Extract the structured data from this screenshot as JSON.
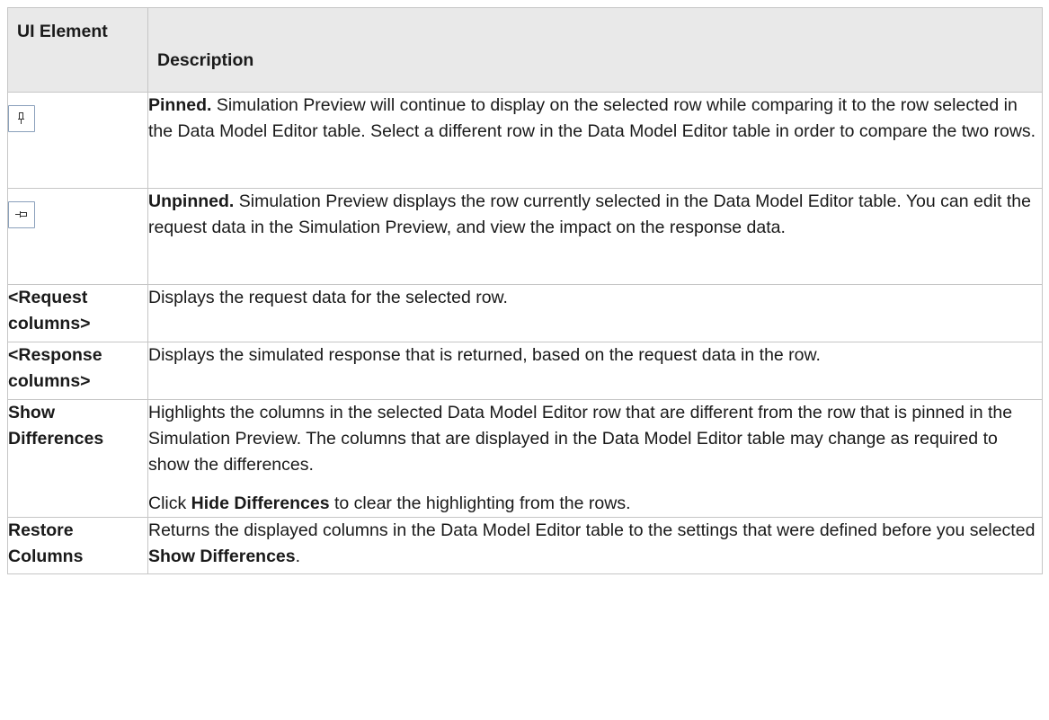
{
  "header": {
    "col1": "UI Element",
    "col2": "Description"
  },
  "rows": [
    {
      "icon": "pin-pinned-icon",
      "term": "Pinned.",
      "text": " Simulation Preview will continue to display on the selected row while comparing it to the row selected in the Data Model Editor table. Select a different row in the Data Model Editor table in order to compare the two rows."
    },
    {
      "icon": "pin-unpinned-icon",
      "term": "Unpinned.",
      "text": " Simulation Preview displays the row currently selected in the Data Model Editor table. You can edit the request data in the Simulation Preview, and view the impact on the response data."
    },
    {
      "element": "<Request columns>",
      "text": "Displays the request data for the selected row."
    },
    {
      "element": "<Response columns>",
      "text": "Displays the simulated response that is returned, based on the request data in the row."
    },
    {
      "element": "Show Differences",
      "text": "Highlights the columns in the selected Data Model Editor row that are different from the row that is pinned in the Simulation Preview. The columns that are displayed in the Data Model Editor table may change as required to show the differences.",
      "note_prefix": "Click ",
      "note_term": "Hide Differences",
      "note_suffix": " to clear the highlighting from the rows."
    },
    {
      "element": "Restore Columns",
      "text_prefix": "Returns the displayed columns in the Data Model Editor table to the settings that were defined before you selected ",
      "text_term": "Show Differences",
      "text_suffix": "."
    }
  ],
  "colors": {
    "header_bg": "#e9e9e9",
    "border": "#c6c6c6",
    "button_border": "#8aa0bb",
    "text": "#1a1a1a"
  }
}
